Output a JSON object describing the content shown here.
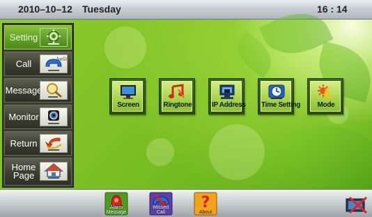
{
  "status_bar": {
    "date": "2010–10–12",
    "weekday": "Tuesday",
    "time": "16 : 14"
  },
  "sidebar": {
    "items": [
      {
        "label": "Setting",
        "icon": "settings-icon",
        "active": true
      },
      {
        "label": "Call",
        "icon": "phone-call-icon",
        "active": false
      },
      {
        "label": "Message",
        "icon": "magnifier-icon",
        "active": false
      },
      {
        "label": "Monitor",
        "icon": "camera-icon",
        "active": false
      },
      {
        "label": "Return",
        "icon": "return-arrow-icon",
        "active": false
      },
      {
        "label": "Home Page",
        "icon": "house-icon",
        "active": false
      }
    ]
  },
  "tiles": [
    {
      "label": "Screen",
      "icon": "monitor-icon"
    },
    {
      "label": "Ringtone",
      "icon": "music-notes-icon"
    },
    {
      "label": "IP Address",
      "icon": "network-icon"
    },
    {
      "label": "Time Setting",
      "icon": "clock-icon"
    },
    {
      "label": "Mode",
      "icon": "sun-moon-icon"
    }
  ],
  "bottom_bar": {
    "buttons": [
      {
        "label": "Alarm Message",
        "icon": "alarm-siren-icon"
      },
      {
        "label": "Missed Call",
        "icon": "missed-call-icon"
      },
      {
        "label": "About",
        "icon": "question-icon"
      }
    ],
    "screen_off_icon": "screen-off-icon"
  },
  "colors": {
    "active_green": "#5f9e25",
    "background_green": "#7fc126",
    "sidebar_dark": "#3a3d2e"
  }
}
